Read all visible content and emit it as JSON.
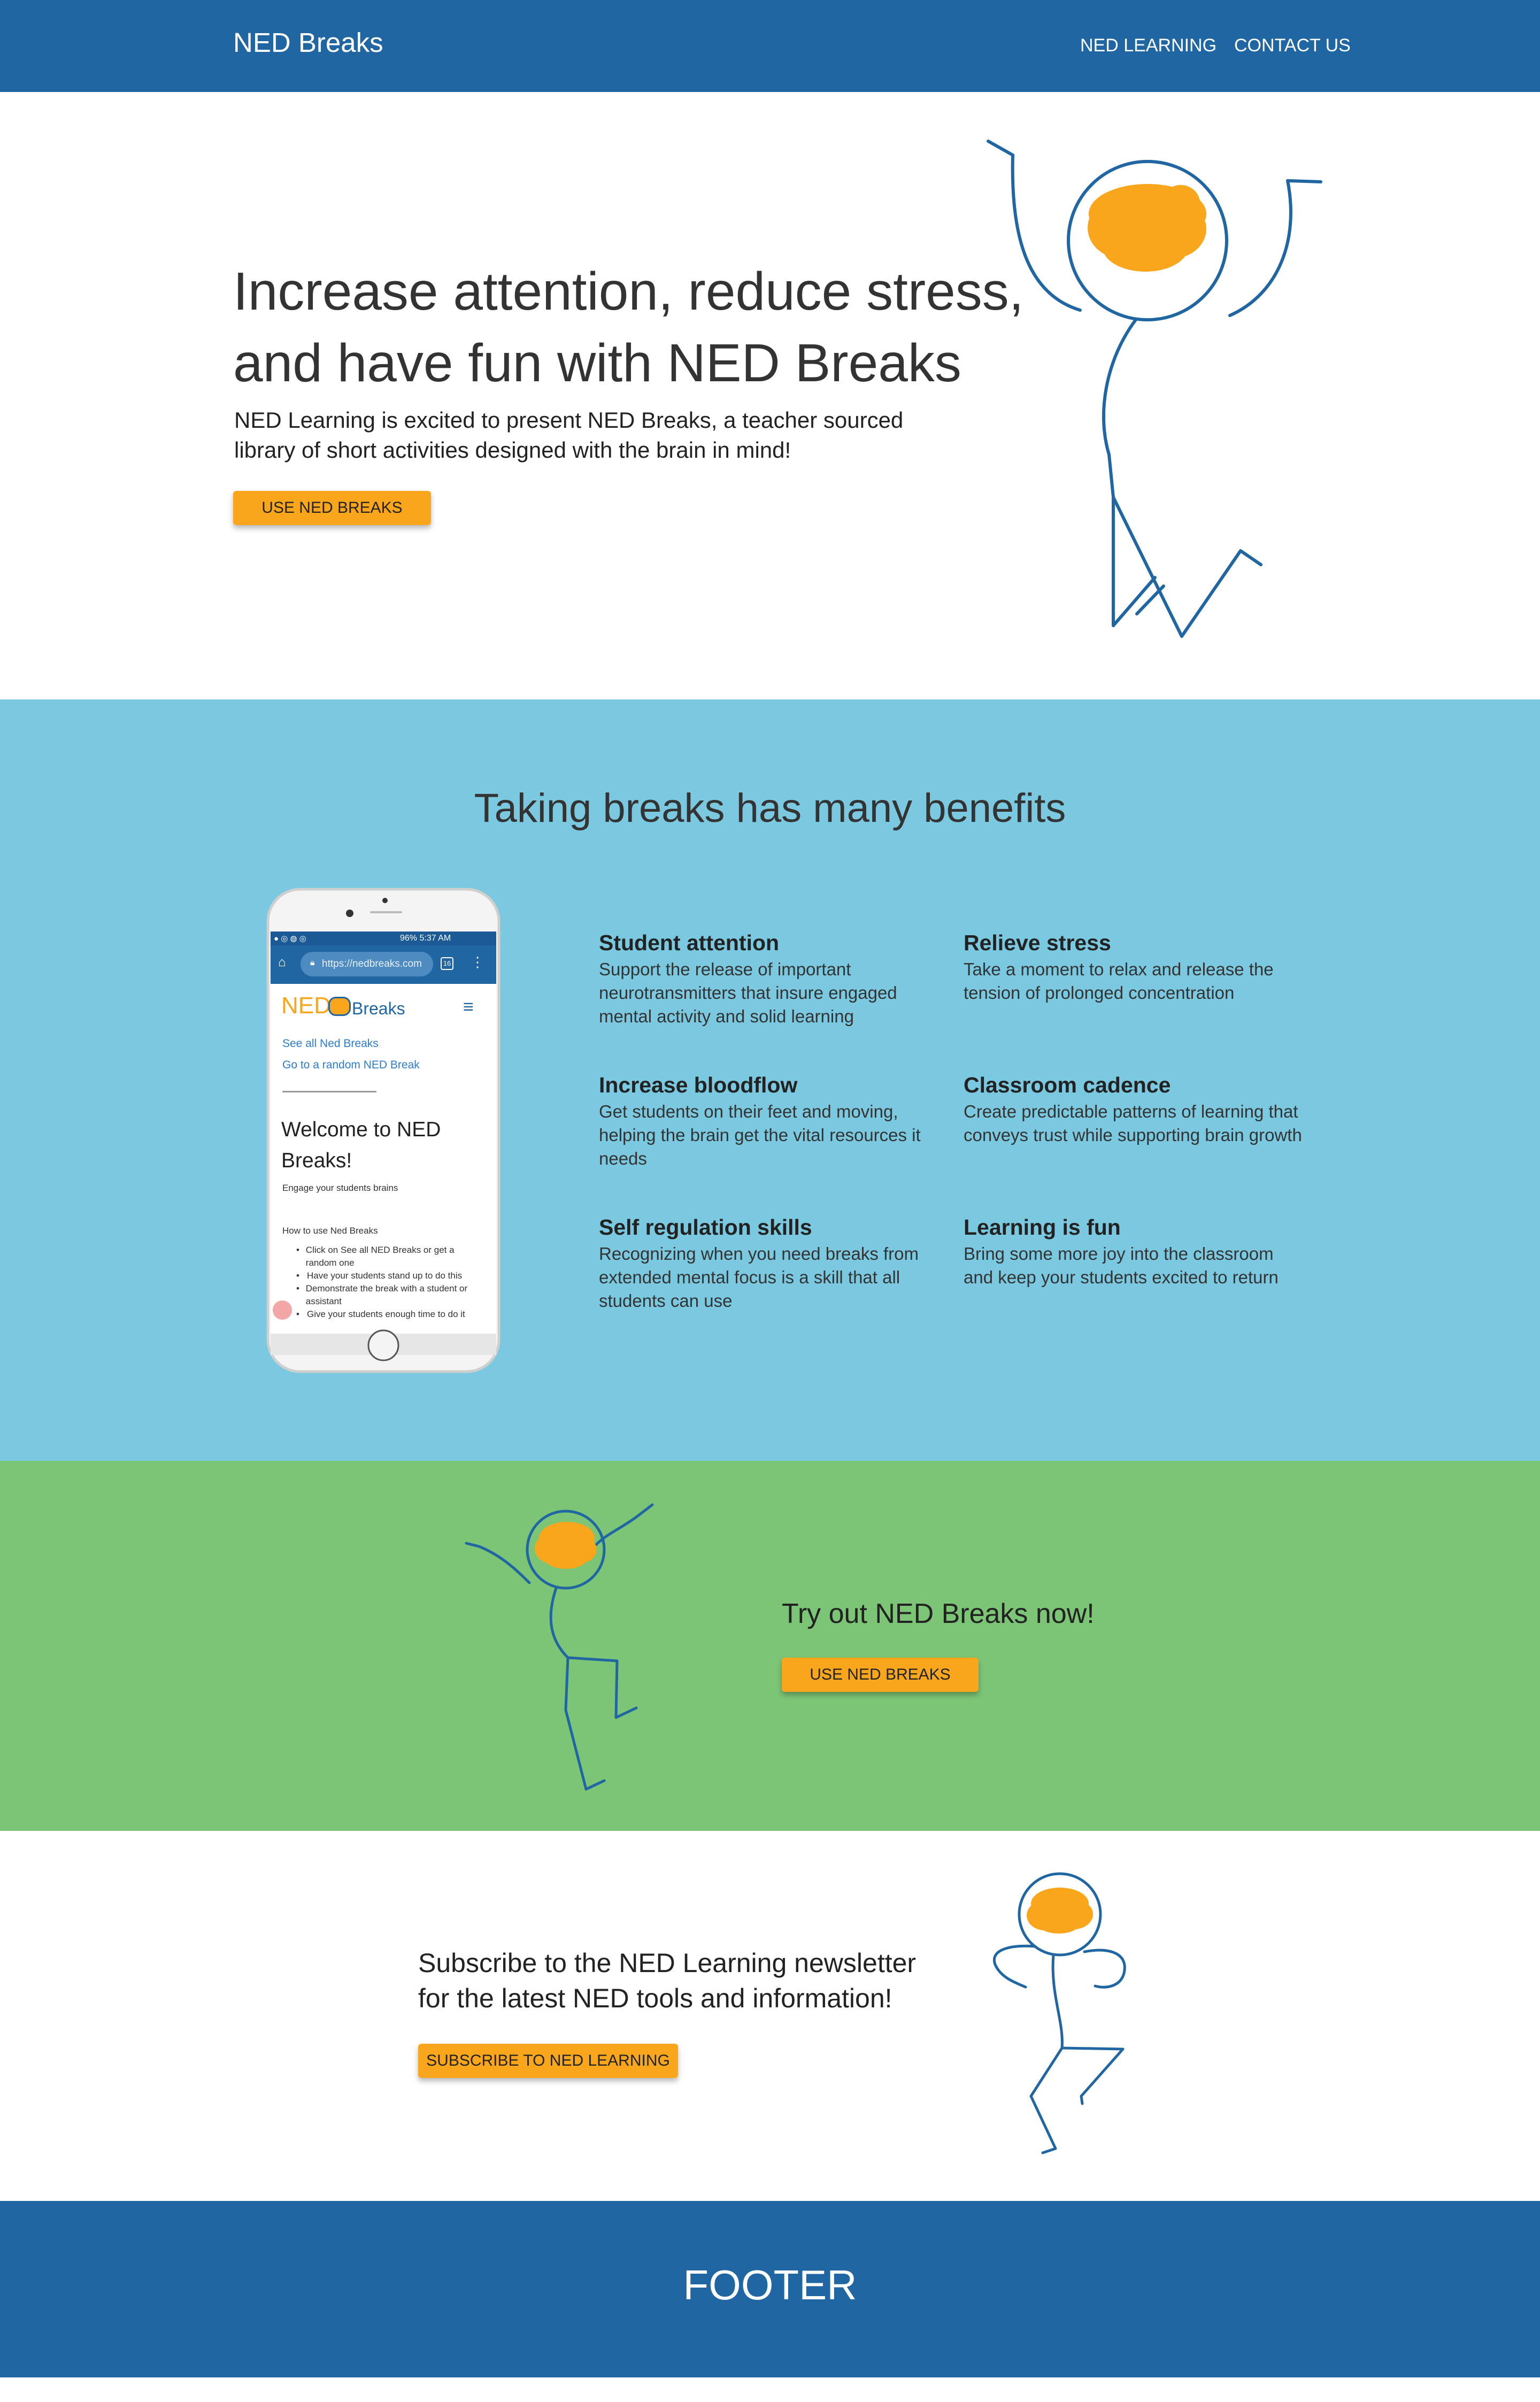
{
  "colors": {
    "nav_bg": "#2066a2",
    "accent_orange": "#f9a61c",
    "benefits_bg": "#7ac9e0",
    "try_bg": "#7cc576",
    "footer_bg": "#2066a2",
    "figure_blue": "#2066a2"
  },
  "nav": {
    "brand": "NED Breaks",
    "links": [
      "NED LEARNING",
      "CONTACT US"
    ]
  },
  "hero": {
    "title": "Increase attention, reduce stress, and have fun with NED Breaks",
    "subtitle": "NED Learning is excited to present NED Breaks, a teacher sourced library of short activities designed with the brain in mind!",
    "button": "USE NED BREAKS"
  },
  "benefits": {
    "title": "Taking breaks has many benefits",
    "items": [
      {
        "title": "Student attention",
        "text": "Support the release of important neurotransmitters that insure engaged mental activity and solid learning"
      },
      {
        "title": "Relieve stress",
        "text": "Take a moment to relax and release the tension of prolonged concentration"
      },
      {
        "title": "Increase bloodflow",
        "text": "Get students on their feet and moving, helping the brain get the vital resources it needs"
      },
      {
        "title": "Classroom cadence",
        "text": "Create predictable patterns of learning that conveys trust while supporting brain growth"
      },
      {
        "title": "Self regulation skills",
        "text": "Recognizing when you need breaks from extended mental focus is a skill that all students can use"
      },
      {
        "title": "Learning is fun",
        "text": "Bring some more joy into the classroom and keep your students excited to return"
      }
    ]
  },
  "phone": {
    "status_right": "96% 5:37 AM",
    "url": "https://nedbreaks.com",
    "tab_count": "16",
    "logo_ned": "NED",
    "logo_breaks": "Breaks",
    "link_all": "See all Ned Breaks",
    "link_random": "Go to a random NED Break",
    "welcome": "Welcome to NED Breaks!",
    "tagline": "Engage your students brains",
    "howto_title": "How to use Ned Breaks",
    "howto_items": [
      "Click on See all NED Breaks or get a random one",
      "Have your students stand up to do this",
      "Demonstrate the break with a student or assistant",
      "Give your students enough time to do it"
    ]
  },
  "try": {
    "title": "Try out NED Breaks now!",
    "button": "USE NED BREAKS"
  },
  "subscribe": {
    "title": "Subscribe to the NED Learning newsletter for the latest NED tools and information!",
    "button": "SUBSCRIBE TO NED LEARNING"
  },
  "footer": {
    "text": "FOOTER"
  }
}
